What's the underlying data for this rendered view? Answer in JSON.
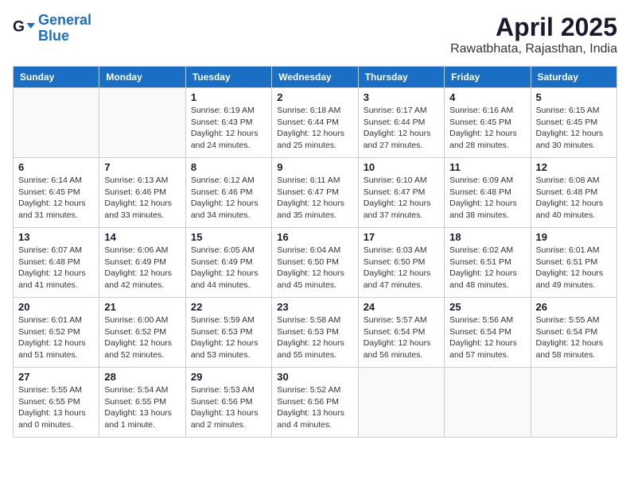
{
  "header": {
    "logo_line1": "General",
    "logo_line2": "Blue",
    "month_year": "April 2025",
    "location": "Rawatbhata, Rajasthan, India"
  },
  "weekdays": [
    "Sunday",
    "Monday",
    "Tuesday",
    "Wednesday",
    "Thursday",
    "Friday",
    "Saturday"
  ],
  "weeks": [
    [
      {
        "day": "",
        "empty": true
      },
      {
        "day": "",
        "empty": true
      },
      {
        "day": "1",
        "sunrise": "6:19 AM",
        "sunset": "6:43 PM",
        "daylight": "12 hours and 24 minutes."
      },
      {
        "day": "2",
        "sunrise": "6:18 AM",
        "sunset": "6:44 PM",
        "daylight": "12 hours and 25 minutes."
      },
      {
        "day": "3",
        "sunrise": "6:17 AM",
        "sunset": "6:44 PM",
        "daylight": "12 hours and 27 minutes."
      },
      {
        "day": "4",
        "sunrise": "6:16 AM",
        "sunset": "6:45 PM",
        "daylight": "12 hours and 28 minutes."
      },
      {
        "day": "5",
        "sunrise": "6:15 AM",
        "sunset": "6:45 PM",
        "daylight": "12 hours and 30 minutes."
      }
    ],
    [
      {
        "day": "6",
        "sunrise": "6:14 AM",
        "sunset": "6:45 PM",
        "daylight": "12 hours and 31 minutes."
      },
      {
        "day": "7",
        "sunrise": "6:13 AM",
        "sunset": "6:46 PM",
        "daylight": "12 hours and 33 minutes."
      },
      {
        "day": "8",
        "sunrise": "6:12 AM",
        "sunset": "6:46 PM",
        "daylight": "12 hours and 34 minutes."
      },
      {
        "day": "9",
        "sunrise": "6:11 AM",
        "sunset": "6:47 PM",
        "daylight": "12 hours and 35 minutes."
      },
      {
        "day": "10",
        "sunrise": "6:10 AM",
        "sunset": "6:47 PM",
        "daylight": "12 hours and 37 minutes."
      },
      {
        "day": "11",
        "sunrise": "6:09 AM",
        "sunset": "6:48 PM",
        "daylight": "12 hours and 38 minutes."
      },
      {
        "day": "12",
        "sunrise": "6:08 AM",
        "sunset": "6:48 PM",
        "daylight": "12 hours and 40 minutes."
      }
    ],
    [
      {
        "day": "13",
        "sunrise": "6:07 AM",
        "sunset": "6:48 PM",
        "daylight": "12 hours and 41 minutes."
      },
      {
        "day": "14",
        "sunrise": "6:06 AM",
        "sunset": "6:49 PM",
        "daylight": "12 hours and 42 minutes."
      },
      {
        "day": "15",
        "sunrise": "6:05 AM",
        "sunset": "6:49 PM",
        "daylight": "12 hours and 44 minutes."
      },
      {
        "day": "16",
        "sunrise": "6:04 AM",
        "sunset": "6:50 PM",
        "daylight": "12 hours and 45 minutes."
      },
      {
        "day": "17",
        "sunrise": "6:03 AM",
        "sunset": "6:50 PM",
        "daylight": "12 hours and 47 minutes."
      },
      {
        "day": "18",
        "sunrise": "6:02 AM",
        "sunset": "6:51 PM",
        "daylight": "12 hours and 48 minutes."
      },
      {
        "day": "19",
        "sunrise": "6:01 AM",
        "sunset": "6:51 PM",
        "daylight": "12 hours and 49 minutes."
      }
    ],
    [
      {
        "day": "20",
        "sunrise": "6:01 AM",
        "sunset": "6:52 PM",
        "daylight": "12 hours and 51 minutes."
      },
      {
        "day": "21",
        "sunrise": "6:00 AM",
        "sunset": "6:52 PM",
        "daylight": "12 hours and 52 minutes."
      },
      {
        "day": "22",
        "sunrise": "5:59 AM",
        "sunset": "6:53 PM",
        "daylight": "12 hours and 53 minutes."
      },
      {
        "day": "23",
        "sunrise": "5:58 AM",
        "sunset": "6:53 PM",
        "daylight": "12 hours and 55 minutes."
      },
      {
        "day": "24",
        "sunrise": "5:57 AM",
        "sunset": "6:54 PM",
        "daylight": "12 hours and 56 minutes."
      },
      {
        "day": "25",
        "sunrise": "5:56 AM",
        "sunset": "6:54 PM",
        "daylight": "12 hours and 57 minutes."
      },
      {
        "day": "26",
        "sunrise": "5:55 AM",
        "sunset": "6:54 PM",
        "daylight": "12 hours and 58 minutes."
      }
    ],
    [
      {
        "day": "27",
        "sunrise": "5:55 AM",
        "sunset": "6:55 PM",
        "daylight": "13 hours and 0 minutes."
      },
      {
        "day": "28",
        "sunrise": "5:54 AM",
        "sunset": "6:55 PM",
        "daylight": "13 hours and 1 minute."
      },
      {
        "day": "29",
        "sunrise": "5:53 AM",
        "sunset": "6:56 PM",
        "daylight": "13 hours and 2 minutes."
      },
      {
        "day": "30",
        "sunrise": "5:52 AM",
        "sunset": "6:56 PM",
        "daylight": "13 hours and 4 minutes."
      },
      {
        "day": "",
        "empty": true
      },
      {
        "day": "",
        "empty": true
      },
      {
        "day": "",
        "empty": true
      }
    ]
  ]
}
